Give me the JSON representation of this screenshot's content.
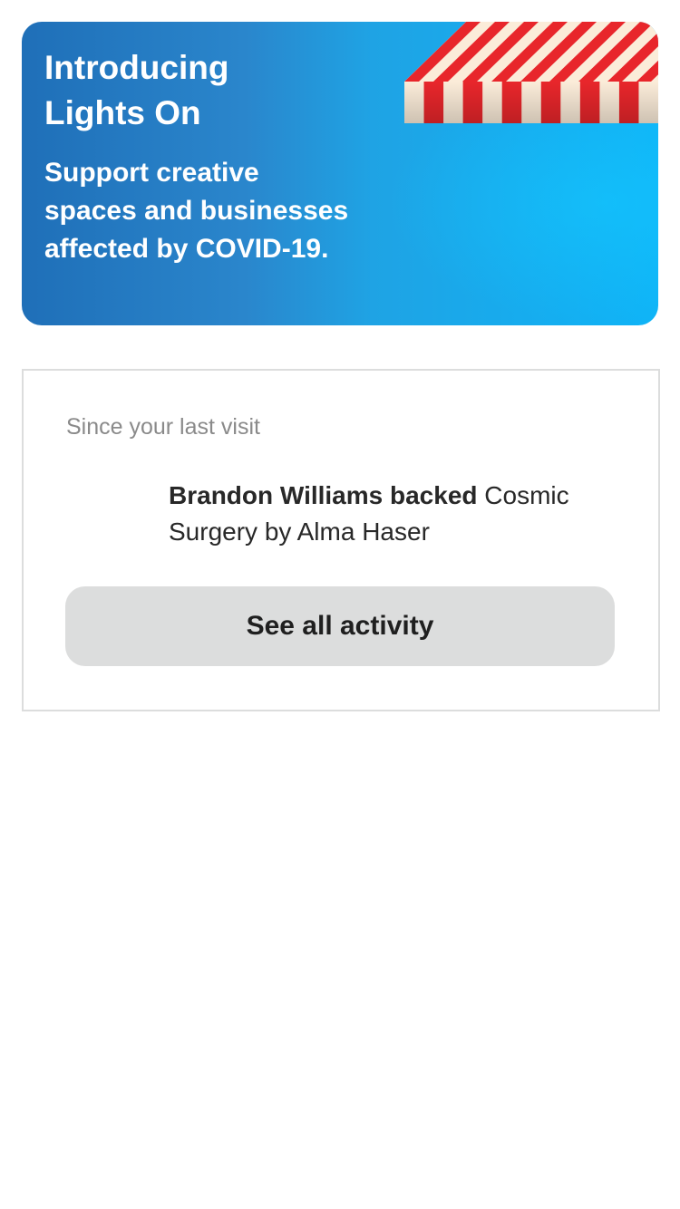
{
  "promo_banner": {
    "title": "Introducing Lights On",
    "subtitle": "Support creative spaces and businesses affected by COVID-19.",
    "colors": {
      "gradient_start": "#1f6fb8",
      "gradient_end": "#0fb4f7",
      "awning_red": "#e8262b",
      "awning_cream": "#fbecd9"
    },
    "illustration": "striped-awning-illustration"
  },
  "activity": {
    "section_label": "Since your last visit",
    "items": [
      {
        "actor_action": "Brandon Williams backed",
        "project": "Cosmic Surgery by Alma Haser"
      }
    ],
    "see_all_label": "See all activity"
  }
}
